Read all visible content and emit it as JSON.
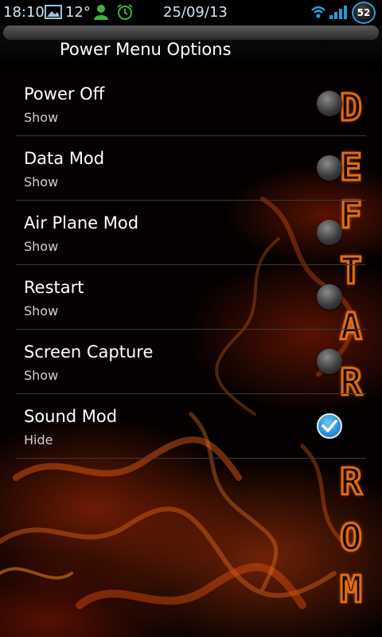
{
  "statusbar": {
    "time": "18:10",
    "temperature": "12°",
    "date": "25/09/13",
    "battery": "52",
    "icons": [
      "picture-icon",
      "user-icon",
      "alarm-icon",
      "wifi-icon",
      "signal-icon",
      "battery-icon"
    ]
  },
  "header": {
    "title": "Power Menu Options"
  },
  "items": [
    {
      "title": "Power Off",
      "subtitle": "Show",
      "checked": false
    },
    {
      "title": "Data Mod",
      "subtitle": "Show",
      "checked": false
    },
    {
      "title": "Air Plane Mod",
      "subtitle": "Show",
      "checked": false
    },
    {
      "title": "Restart",
      "subtitle": "Show",
      "checked": false
    },
    {
      "title": "Screen Capture",
      "subtitle": "Show",
      "checked": false
    },
    {
      "title": "Sound Mod",
      "subtitle": "Hide",
      "checked": true
    }
  ],
  "brand": {
    "letters": [
      "D",
      "E",
      "F",
      "T",
      "A",
      "R",
      "R",
      "O",
      "M"
    ]
  },
  "colors": {
    "accent_blue": "#2a8fd4",
    "flame_orange": "#e06c14",
    "status_green": "#3db33d"
  }
}
